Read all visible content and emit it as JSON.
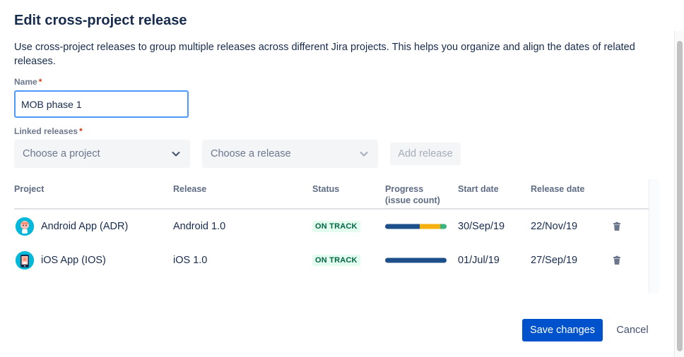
{
  "dialog": {
    "title": "Edit cross-project release",
    "description": "Use cross-project releases to group multiple releases across different Jira projects. This helps you organize and align the dates of related releases."
  },
  "name_field": {
    "label": "Name",
    "required_marker": "*",
    "value": "MOB phase 1"
  },
  "linked_releases": {
    "label": "Linked releases",
    "required_marker": "*",
    "project_select_placeholder": "Choose a project",
    "release_select_placeholder": "Choose a release",
    "add_button_label": "Add release"
  },
  "table": {
    "headers": {
      "project": "Project",
      "release": "Release",
      "status": "Status",
      "progress_line1": "Progress",
      "progress_line2": "(issue count)",
      "start_date": "Start date",
      "release_date": "Release date"
    },
    "rows": [
      {
        "project": "Android App (ADR)",
        "avatar_icon": "android-app-avatar-icon",
        "release": "Android 1.0",
        "status": "ON TRACK",
        "progress": {
          "done": 0.56,
          "in_progress": 0.34,
          "todo": 0.1
        },
        "start_date": "30/Sep/19",
        "release_date": "22/Nov/19"
      },
      {
        "project": "iOS App (IOS)",
        "avatar_icon": "ios-app-avatar-icon",
        "release": "iOS 1.0",
        "status": "ON TRACK",
        "progress": {
          "done": 1.0,
          "in_progress": 0.0,
          "todo": 0.0
        },
        "start_date": "01/Jul/19",
        "release_date": "27/Sep/19"
      }
    ]
  },
  "footer": {
    "save_label": "Save changes",
    "cancel_label": "Cancel"
  },
  "colors": {
    "primary": "#0052cc",
    "progress_done": "#1d4f8a",
    "progress_in_progress": "#f6b00e",
    "progress_todo": "#36b37e",
    "status_bg": "#e3fcef",
    "status_text": "#006644",
    "focus_border": "#4c9aff"
  }
}
